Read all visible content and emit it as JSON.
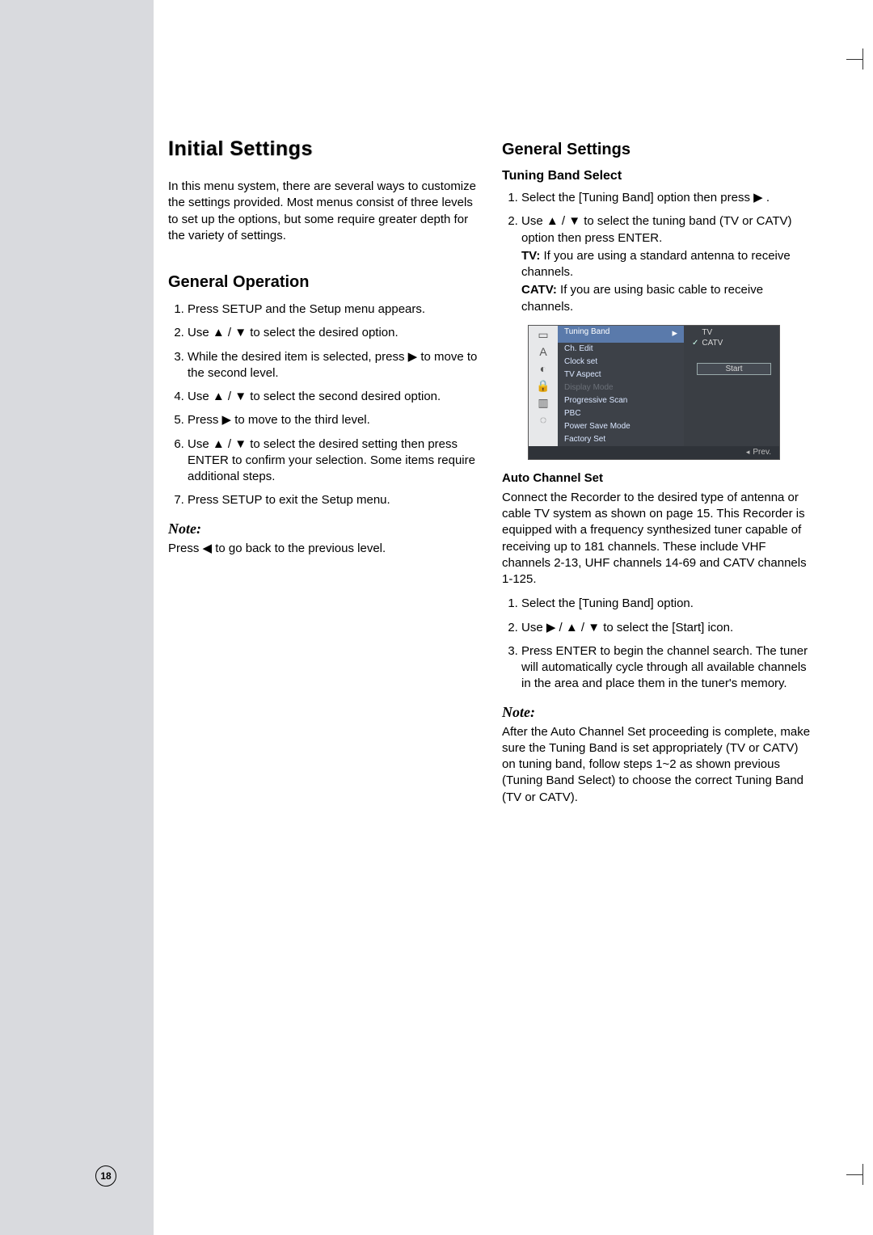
{
  "page_number": "18",
  "title": "Initial Settings",
  "intro": "In this menu system, there are several ways to customize the settings provided. Most menus consist of three levels to set up the options, but some require greater depth for the variety of settings.",
  "left": {
    "heading": "General Operation",
    "steps": [
      "Press SETUP and the Setup menu appears.",
      "Use ▲ / ▼ to select the desired option.",
      "While the desired item is selected, press ▶ to move to the second level.",
      "Use ▲ / ▼ to select the second desired option.",
      "Press ▶ to move to the third level.",
      "Use ▲ / ▼ to select the desired setting then press ENTER to confirm your selection. Some items require additional steps.",
      "Press SETUP to exit the Setup menu."
    ],
    "note_label": "Note:",
    "note_body": "Press ◀  to go back to the previous level."
  },
  "right": {
    "heading": "General Settings",
    "tbs_heading": "Tuning Band Select",
    "tbs_steps": [
      "Select the [Tuning Band] option then press ▶ .",
      "Use ▲ / ▼ to select the tuning band (TV or CATV)  option then press ENTER."
    ],
    "tv_label": "TV:",
    "tv_text": " If you are using a standard antenna to receive channels.",
    "catv_label": "CATV:",
    "catv_text": " If you are using basic cable to receive channels.",
    "osd": {
      "menu_items": [
        "Tuning Band",
        "Ch. Edit",
        "Clock set",
        "TV Aspect",
        "Display Mode",
        "Progressive Scan",
        "PBC",
        "Power Save Mode",
        "Factory Set"
      ],
      "right_items": [
        "TV",
        "CATV"
      ],
      "start_label": "Start",
      "footer": "Prev."
    },
    "acs_heading": "Auto Channel Set",
    "acs_intro": "Connect the Recorder to the desired type of antenna or cable TV system as shown on page 15. This Recorder is equipped with a frequency synthesized tuner capable of receiving up to 181 channels. These include VHF channels 2-13, UHF channels 14-69 and CATV channels 1-125.",
    "acs_steps": [
      "Select the [Tuning Band] option.",
      "Use ▶ / ▲ / ▼ to select the [Start] icon.",
      "Press ENTER to begin the channel search. The tuner will automatically cycle through all available channels in the area and place them in the tuner's memory."
    ],
    "note_label": "Note:",
    "note_body": "After the Auto Channel Set proceeding is complete, make sure the Tuning Band is set appropriately (TV or CATV) on tuning band, follow steps 1~2 as shown previous (Tuning Band Select) to choose the correct Tuning Band (TV or CATV)."
  }
}
